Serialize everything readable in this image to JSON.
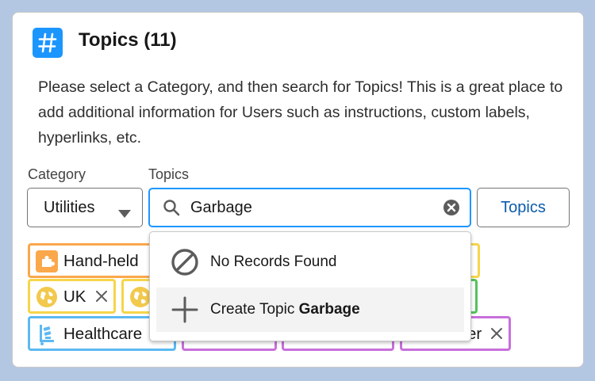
{
  "header": {
    "title": "Topics (11)",
    "icon": "hashtag-icon"
  },
  "description": "Please select a Category, and then search for Topics! This is a great place to add additional information for Users such as instructions, custom labels, hyperlinks, etc.",
  "category": {
    "label": "Category",
    "value": "Utilities"
  },
  "topics": {
    "label": "Topics",
    "search_value": "Garbage",
    "button_label": "Topics"
  },
  "pills": [
    {
      "label": "Hand-held",
      "color": "#fba74b",
      "icon": "puzzle-icon"
    },
    {
      "label": "UK",
      "color": "#f6d54a",
      "icon": "globe-icon"
    },
    {
      "label": "",
      "color": "#f6d54a",
      "icon": "globe-icon"
    },
    {
      "label": "Healthcare",
      "color": "#5cb9f2",
      "icon": "dolly-icon"
    },
    {
      "label": "er",
      "color": "#c86fdc",
      "icon": "tag-icon"
    }
  ],
  "dropdown": {
    "no_records": "No Records Found",
    "create_prefix": "Create Topic ",
    "create_term": "Garbage"
  },
  "colors": {
    "accent": "#1b96ff",
    "brand_link": "#0b5cab",
    "background": "#b4c7e2"
  }
}
